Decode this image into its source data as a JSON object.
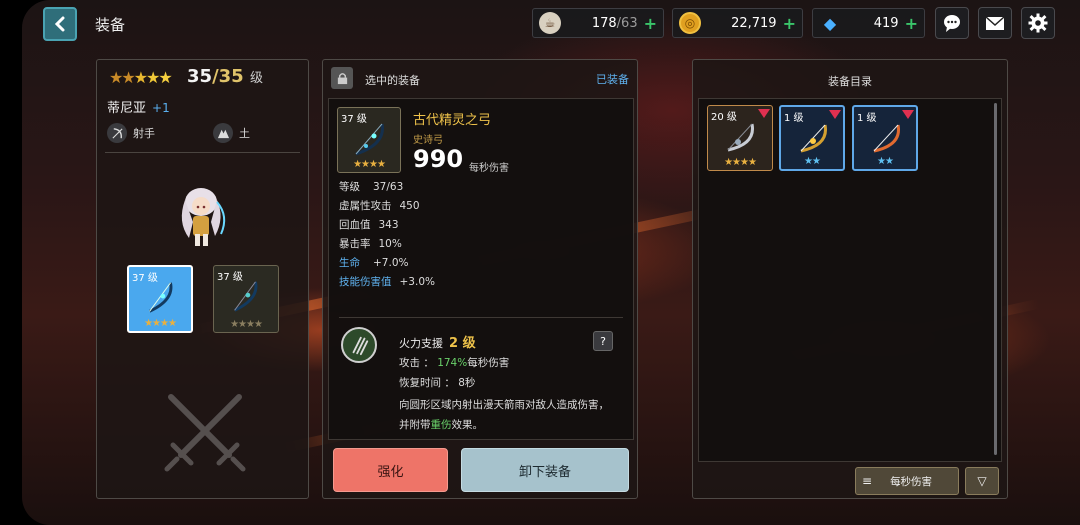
{
  "header": {
    "title": "装备",
    "resources": {
      "stamina": {
        "current": "178",
        "max": "/63",
        "icon": "coffee-cup-icon"
      },
      "gold": {
        "value": "22,719",
        "icon": "coin-icon"
      },
      "gems": {
        "value": "419",
        "icon": "gem-icon"
      }
    },
    "plus_label": "+"
  },
  "hero": {
    "level": "35",
    "max_level": "/35",
    "level_unit": "级",
    "star_count": 5,
    "name": "蒂尼亚",
    "name_plus": "+1",
    "class_label": "射手",
    "element_label": "土",
    "slots": [
      {
        "level": "37 级",
        "stars": "★★★★"
      },
      {
        "level": "37 级",
        "stars": "★★★★"
      }
    ]
  },
  "selected": {
    "header": "选中的装备",
    "status": "已装备",
    "item": {
      "level": "37 级",
      "stars": "★★★★",
      "name": "古代精灵之弓",
      "type": "史诗弓",
      "dps": "990",
      "dps_label": "每秒伤害"
    },
    "stats": [
      {
        "key": "等级",
        "value": "37/63"
      },
      {
        "key": "虚属性攻击",
        "value": "450"
      },
      {
        "key": "回血值",
        "value": "343"
      },
      {
        "key": "暴击率",
        "value": "10%"
      },
      {
        "key": "生命",
        "value": "+7.0%"
      },
      {
        "key": "技能伤害值",
        "value": "+3.0%"
      }
    ],
    "skill": {
      "name": "火力支援",
      "level": "2 级",
      "help": "?",
      "attack_label": "攻击 ：",
      "attack_value": "174%",
      "attack_suffix": "每秒伤害",
      "cooldown_label": "恢复时间 ：",
      "cooldown_value": "8秒",
      "desc_part1": "向圆形区域内射出漫天箭雨对敌人造成伤害，并附带",
      "desc_highlight": "重伤",
      "desc_part2": "效果。"
    },
    "buttons": {
      "enhance": "强化",
      "unequip": "卸下装备"
    }
  },
  "inventory": {
    "title": "装备目录",
    "items": [
      {
        "level": "20 级",
        "stars": "★★★★"
      },
      {
        "level": "1 级",
        "stars": "★★"
      },
      {
        "level": "1 级",
        "stars": "★★"
      }
    ],
    "sort_label": "每秒伤害",
    "sort_icon": "≡",
    "order_icon": "▽"
  },
  "colors": {
    "accent_gold": "#eec24a",
    "accent_blue": "#5fb1ee",
    "highlight_green": "#6ad06a",
    "enhance_btn": "#ee7468",
    "unequip_btn": "#a6c2cc"
  }
}
